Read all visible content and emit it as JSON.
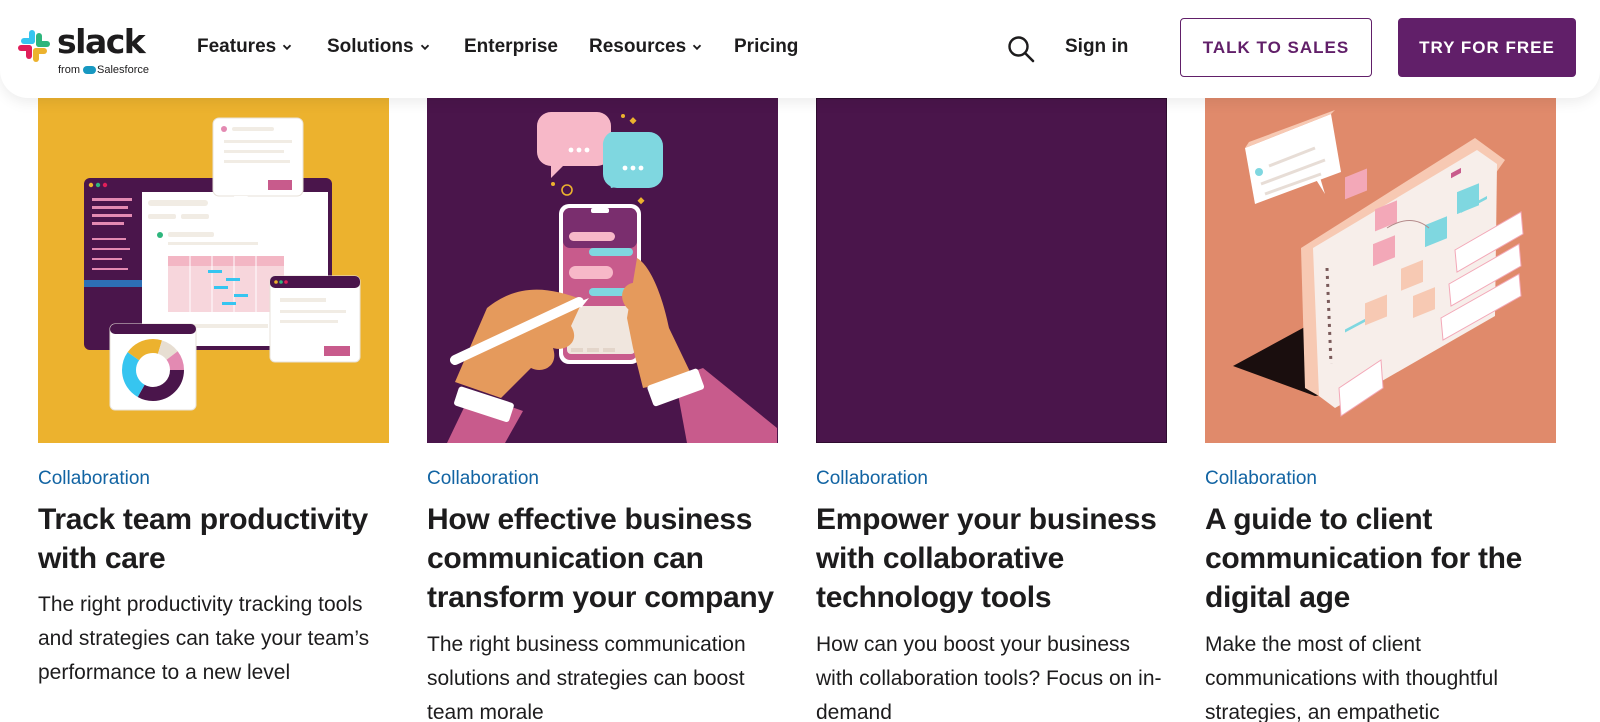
{
  "brand": {
    "logo_word": "slack",
    "logo_sub_prefix": "from",
    "logo_sub_brand": "Salesforce"
  },
  "nav": {
    "items": [
      {
        "label": "Features",
        "has_dropdown": true
      },
      {
        "label": "Solutions",
        "has_dropdown": true
      },
      {
        "label": "Enterprise",
        "has_dropdown": false
      },
      {
        "label": "Resources",
        "has_dropdown": true
      },
      {
        "label": "Pricing",
        "has_dropdown": false
      }
    ],
    "search_icon": "search-icon",
    "sign_in": "Sign in",
    "talk_to_sales": "TALK TO SALES",
    "try_for_free": "TRY FOR FREE"
  },
  "cards": [
    {
      "tag": "Collaboration",
      "title": "Track team productivity with care",
      "description": "The right productivity tracking tools and strategies can take your team’s performance to a new level",
      "thumb_color": "#ecb22e"
    },
    {
      "tag": "Collaboration",
      "title": "How effective business communication can transform your company",
      "description": "The right business communication solutions and strategies can boost team morale",
      "thumb_color": "#4a154b"
    },
    {
      "tag": "Collaboration",
      "title": "Empower your business with collaborative technology tools",
      "description": "How can you boost your business with collaboration tools? Focus on in-demand",
      "thumb_color": "#4a154b"
    },
    {
      "tag": "Collaboration",
      "title": "A guide to client communication for the digital age",
      "description": "Make the most of client communications with thoughtful strategies, an empathetic",
      "thumb_color": "#e08a6b"
    }
  ],
  "colors": {
    "aubergine": "#611f69",
    "link_blue": "#1264a3",
    "text": "#1d1c1d"
  }
}
